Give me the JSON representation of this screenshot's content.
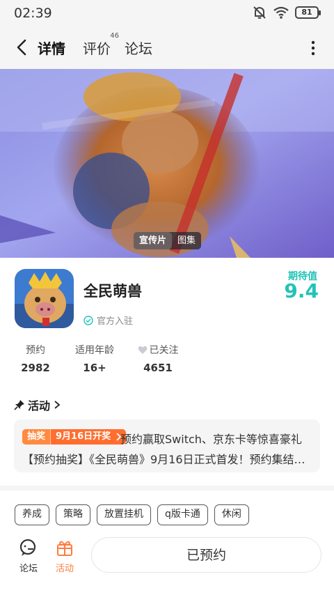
{
  "status_bar": {
    "time": "02:39",
    "battery": "81"
  },
  "nav": {
    "tabs": [
      {
        "label": "详情"
      },
      {
        "label": "评价",
        "badge": "46"
      },
      {
        "label": "论坛"
      }
    ]
  },
  "hero": {
    "media_tabs": [
      "宣传片",
      "图集"
    ]
  },
  "game": {
    "title": "全民萌兽",
    "official_label": "官方入驻",
    "expect_label": "期待值",
    "expect_score": "9.4",
    "stats": [
      {
        "label": "预约",
        "value": "2982"
      },
      {
        "label": "适用年龄",
        "value": "16+"
      },
      {
        "label": "已关注",
        "value": "4651"
      }
    ]
  },
  "activity": {
    "header": "活动",
    "tag_main": "抽奖",
    "tag_date": "9月16日开奖",
    "line1": "预约赢取Switch、京东卡等惊喜豪礼",
    "line2": "【预约抽奖】《全民萌兽》9月16日正式首发！预约集结赢..."
  },
  "tags": [
    "养成",
    "策略",
    "放置挂机",
    "q版卡通",
    "休闲"
  ],
  "bottom_bar": {
    "forum_label": "论坛",
    "activity_label": "活动",
    "reserve_label": "已预约"
  },
  "colors": {
    "accent": "#22c3b7",
    "orange": "#ff7a3d"
  }
}
